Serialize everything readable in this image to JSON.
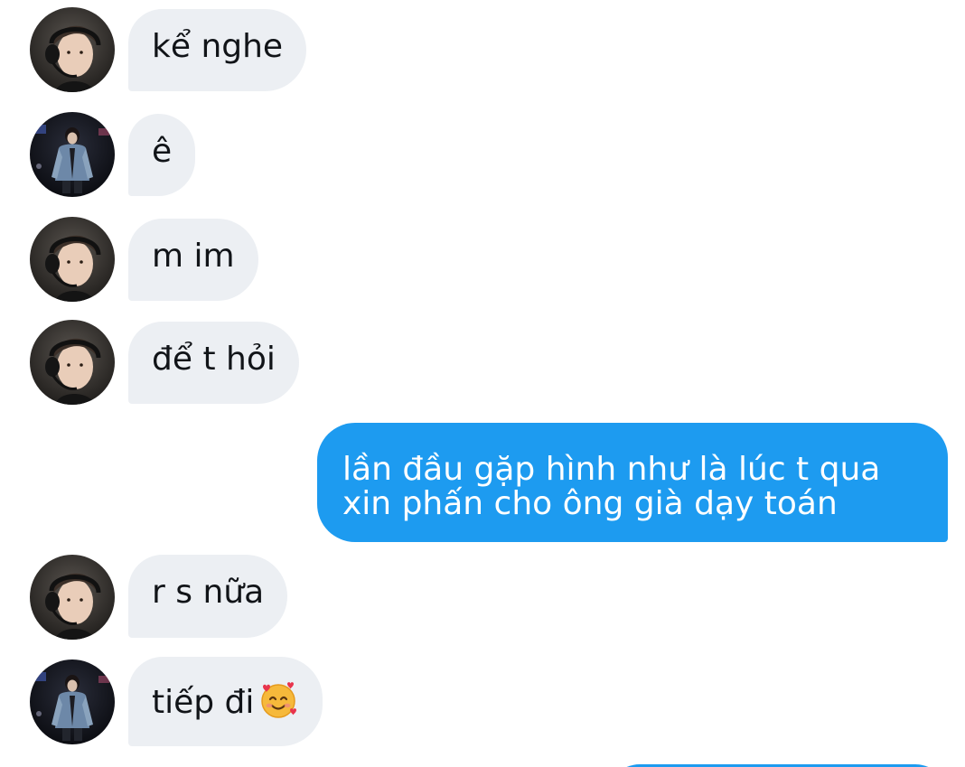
{
  "conversation": {
    "messages": [
      {
        "sender": "friend-headset",
        "text": "kể nghe"
      },
      {
        "sender": "friend-denim",
        "text": "ê"
      },
      {
        "sender": "friend-headset",
        "text": "m im"
      },
      {
        "sender": "friend-headset",
        "text": "để t hỏi"
      },
      {
        "sender": "me",
        "text": "lần đầu gặp hình như là lúc t qua xin phấn cho ông già dạy toán"
      },
      {
        "sender": "friend-headset",
        "text": "r s nữa"
      },
      {
        "sender": "friend-denim",
        "text": "tiếp đi",
        "emoji": "smiling-face-with-hearts-emoji"
      }
    ]
  },
  "colors": {
    "incoming_bubble": "#eceff3",
    "outgoing_bubble": "#1d9bf0",
    "text_dark": "#111418",
    "text_light": "#ffffff",
    "background": "#ffffff"
  },
  "icons": {
    "avatar_headset": "avatar-headset-icon",
    "avatar_denim": "avatar-denim-jacket-icon",
    "emoji": "smiling-face-with-hearts-emoji"
  }
}
